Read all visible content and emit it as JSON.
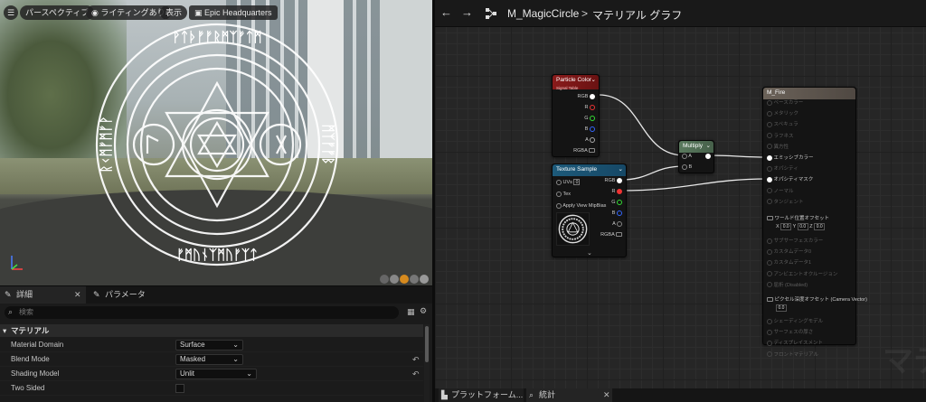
{
  "viewport": {
    "perspective_label": "パースペクティブ",
    "lighting_label": "ライティングあり",
    "show_label": "表示",
    "level_label": "Epic Headquarters",
    "circle_runes_top": "ᚹᛏᚦᚠᚠᚱᛗᛉᚠᛏᛗ",
    "circle_runes_left": "ᚱᚲᛗᚠᛗᚠᚹ",
    "circle_runes_bottom": "ᚠᛗᚢᚾᛉᛗᚢᚠᛉᛏ",
    "circle_runes_right": "ᛗᛉᚠᚠᛒ"
  },
  "details": {
    "tab_details": "詳細",
    "tab_params": "パラメータ",
    "search_placeholder": "検索",
    "section_title": "マテリアル",
    "props": [
      {
        "label": "Material Domain",
        "value": "Surface"
      },
      {
        "label": "Blend Mode",
        "value": "Masked"
      },
      {
        "label": "Shading Model",
        "value": "Unlit"
      },
      {
        "label": "Two Sided",
        "value": ""
      }
    ]
  },
  "graph": {
    "material_name": "M_MagicCircle",
    "crumb_sep": ">",
    "graph_name": "マテリアル グラフ",
    "watermark": "マテ",
    "nodes": {
      "particle": {
        "title": "Particle Color",
        "subtitle": "Signal Table",
        "pins": [
          "RGB",
          "R",
          "G",
          "B",
          "A",
          "RGBA"
        ]
      },
      "texture": {
        "title": "Texture Sample",
        "inputs": [
          "UVs",
          "Tex",
          "Apply View MipBias"
        ],
        "uv_value": "0",
        "outputs": [
          "RGB",
          "R",
          "G",
          "B",
          "A",
          "RGBA"
        ]
      },
      "multiply": {
        "title": "Multiply",
        "inputs": [
          "A",
          "B"
        ]
      },
      "result": {
        "title": "M_Fire",
        "pins": [
          {
            "label": "ベースカラー",
            "active": false
          },
          {
            "label": "メタリック",
            "active": false
          },
          {
            "label": "スペキュラ",
            "active": false
          },
          {
            "label": "ラフネス",
            "active": false
          },
          {
            "label": "異方性",
            "active": false
          },
          {
            "label": "エミッシブカラー",
            "active": true
          },
          {
            "label": "オパシティ",
            "active": false
          },
          {
            "label": "オパシティマスク",
            "active": true
          },
          {
            "label": "ノーマル",
            "active": false
          },
          {
            "label": "タンジェント",
            "active": false
          }
        ],
        "wpo_label": "ワールド位置オフセット",
        "wpo_x": "0.0",
        "wpo_y": "0.0",
        "wpo_z": "0.0",
        "pins2": [
          {
            "label": "サブサーフェスカラー"
          },
          {
            "label": "カスタムデータ0"
          },
          {
            "label": "カスタムデータ1"
          },
          {
            "label": "アンビエントオクルージョン"
          },
          {
            "label": "屈折 (Disabled)"
          }
        ],
        "pixel_depth_label": "ピクセル深度オフセット (Camera Vector)",
        "pixel_depth_value": "0.0",
        "pins3": [
          {
            "label": "シェーディングモデル"
          },
          {
            "label": "サーフェスの厚さ"
          },
          {
            "label": "ディスプレイスメント"
          },
          {
            "label": "フロントマテリアル"
          }
        ]
      }
    }
  },
  "bottom": {
    "platform_label": "プラットフォーム...",
    "stats_label": "統計"
  },
  "colors": {
    "particle_header": "#8a1b1b",
    "texture_header": "#1d5a7a",
    "multiply_header": "#5a7a5e",
    "result_header": "#6b6259"
  }
}
